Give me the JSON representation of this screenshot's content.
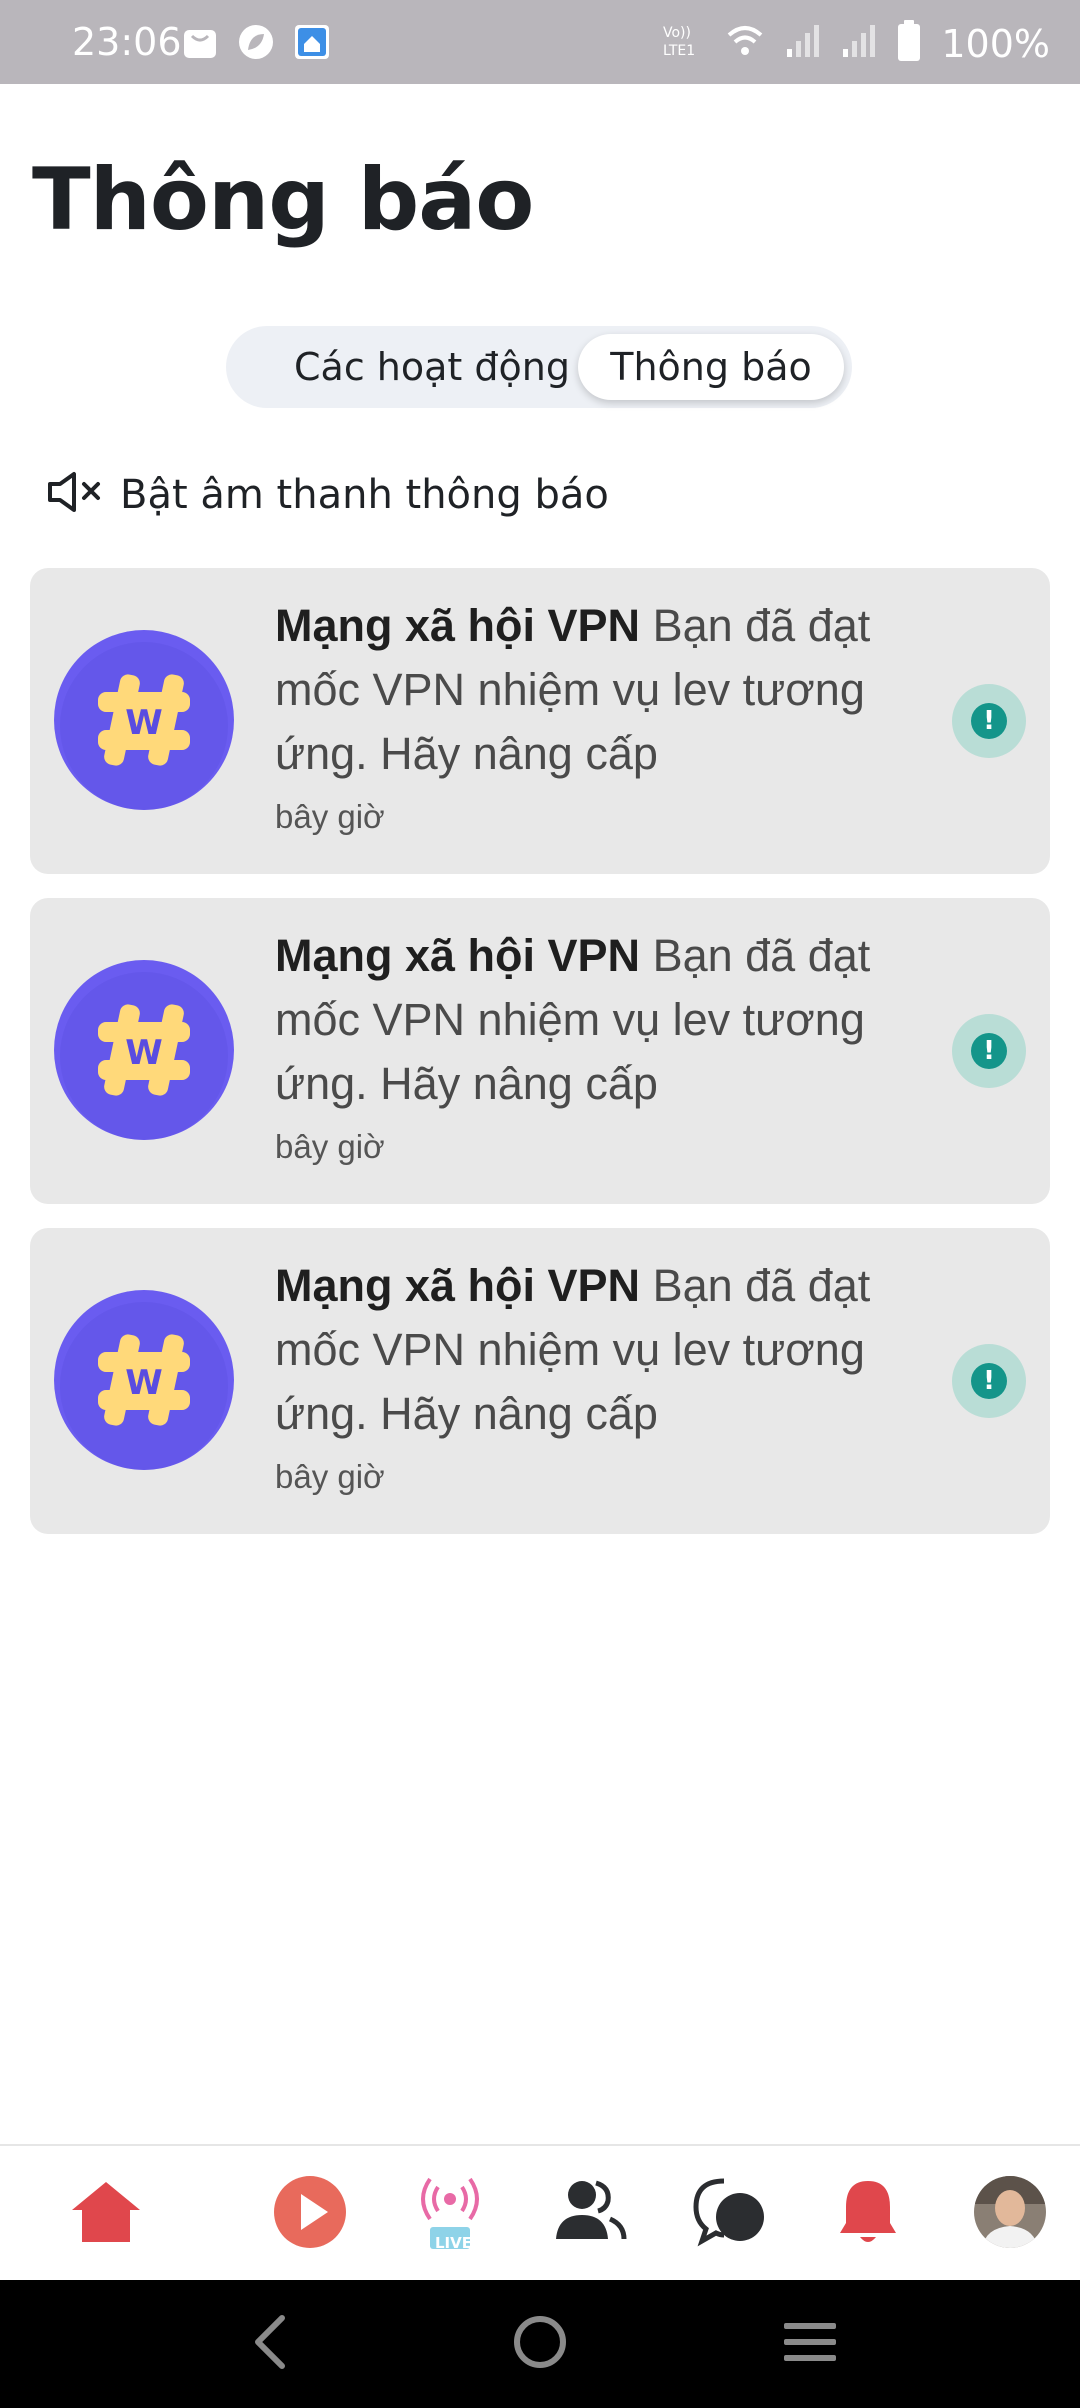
{
  "status_bar": {
    "time": "23:06",
    "battery": "100%",
    "left_icons": [
      "shopping-bag-icon",
      "leaf-app-icon",
      "home-app-icon"
    ],
    "right_icons": [
      "volte-icon",
      "wifi-icon",
      "signal-icon",
      "signal-icon",
      "battery-icon"
    ]
  },
  "page": {
    "title": "Thông báo"
  },
  "tabs": {
    "activities": "Các hoạt động",
    "notifications": "Thông báo",
    "selected": "notifications"
  },
  "mute": {
    "label": "Bật âm thanh thông báo",
    "icon": "speaker-muted-icon"
  },
  "notifications": [
    {
      "sender": "Mạng xã hội VPN",
      "message": " Bạn đã đạt mốc VPN nhiệm vụ lev tương ứng. Hãy nâng cấp",
      "time": "bây giờ",
      "badge": "!"
    },
    {
      "sender": "Mạng xã hội VPN",
      "message": " Bạn đã đạt mốc VPN nhiệm vụ lev tương ứng. Hãy nâng cấp",
      "time": "bây giờ",
      "badge": "!"
    },
    {
      "sender": "Mạng xã hội VPN",
      "message": " Bạn đã đạt mốc VPN nhiệm vụ lev tương ứng. Hãy nâng cấp",
      "time": "bây giờ",
      "badge": "!"
    }
  ],
  "bottom_nav": {
    "items": [
      "home-icon",
      "play-icon",
      "live-icon",
      "friends-icon",
      "chat-icon",
      "bell-icon",
      "profile-avatar"
    ],
    "live_label": "LIVE"
  },
  "colors": {
    "accent_red": "#e0474c",
    "live_pink": "#e86aa6",
    "avatar_purple": "#6a5cf0",
    "badge_teal": "#14958a",
    "card_bg": "#e8e8e8"
  }
}
